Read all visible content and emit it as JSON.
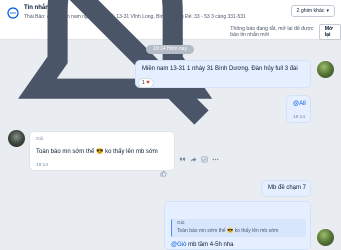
{
  "header": {
    "title": "Tin nhắn",
    "pinned": "Thái Bảo: @All Miền nam ngày 17/12 số: 13-31 Vĩnh Long, Bình Dương Đề: 33 - 53 3 càng 331-531",
    "more_button": "2 ghim khác"
  },
  "notice": {
    "text": "Thông báo đang tắt, mở lại để được báo tin nhắn mới",
    "button": "Mở lại"
  },
  "time_divider": "19:14 Hôm nay",
  "messages": {
    "m1": {
      "text": "Miền nam 13-31 1 nháy 31 Bình Dương. Đàn hủy full 3 đài",
      "reaction_count": "1",
      "reaction_heart": "♥"
    },
    "m2": {
      "mention": "@All",
      "time": "19:14"
    },
    "m3": {
      "sender": "Giò",
      "text_before": "Toàn báo mn sớm thế",
      "emoji": "😎",
      "text_after": "ko thấy lên mb sớm",
      "time": "19:14"
    },
    "m4": {
      "text": "Mb đề chạm 7"
    },
    "m5": {
      "quote_name": "Giò",
      "quote_text": "Toàn báo mn sớm thế 😎 ko thấy lên mb sớm",
      "mention": "@Giò",
      "text": " mb tầm 4-5h nha"
    }
  },
  "colors": {
    "my_bubble": "#e5efff",
    "other_bubble": "#ffffff",
    "background": "#e9ecf1",
    "link": "#005ae0",
    "heart": "#e8373d"
  }
}
